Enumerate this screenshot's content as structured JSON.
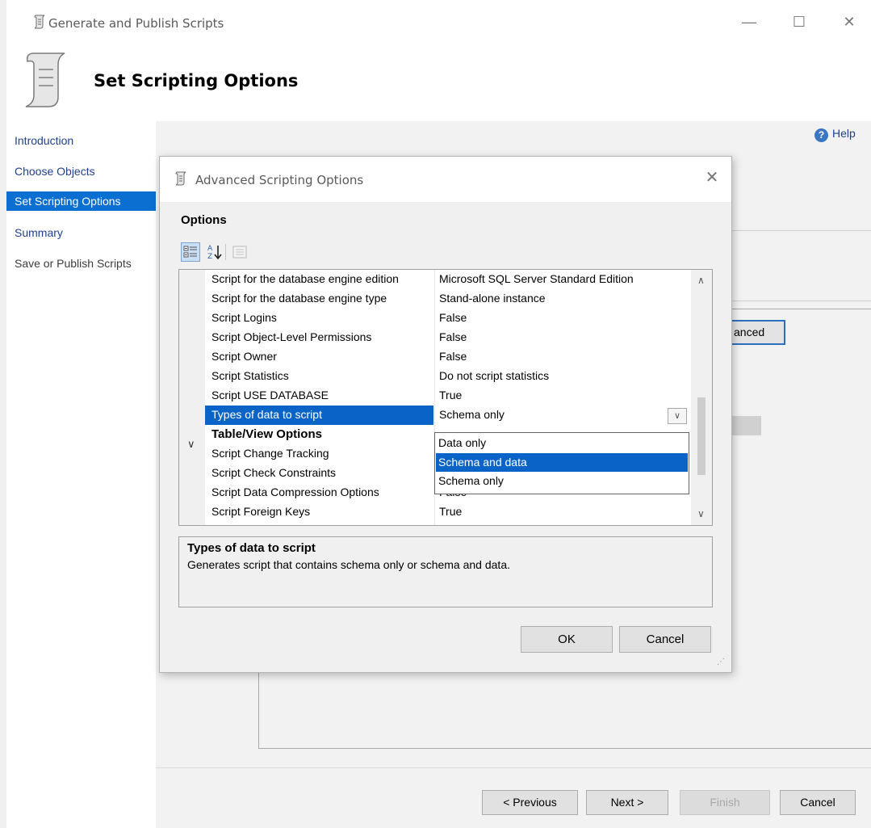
{
  "window": {
    "title": "Generate and Publish Scripts",
    "minimize": "—",
    "maximize": "☐",
    "close": "✕"
  },
  "header": {
    "title": "Set Scripting Options"
  },
  "help": {
    "label": "Help",
    "icon": "?"
  },
  "sidebar": {
    "items": [
      {
        "label": "Introduction"
      },
      {
        "label": "Choose Objects"
      },
      {
        "label": "Set Scripting Options"
      },
      {
        "label": "Summary"
      },
      {
        "label": "Save or Publish Scripts"
      }
    ]
  },
  "background": {
    "advanced_button_label": "anced"
  },
  "footer": {
    "previous": "< Previous",
    "next": "Next >",
    "finish": "Finish",
    "cancel": "Cancel"
  },
  "dialog": {
    "title": "Advanced Scripting Options",
    "close": "✕",
    "options_label": "Options",
    "grid": {
      "rows": [
        {
          "name": "Script for the database engine edition",
          "value": "Microsoft SQL Server Standard Edition"
        },
        {
          "name": "Script for the database engine type",
          "value": "Stand-alone instance"
        },
        {
          "name": "Script Logins",
          "value": "False"
        },
        {
          "name": "Script Object-Level Permissions",
          "value": "False"
        },
        {
          "name": "Script Owner",
          "value": "False"
        },
        {
          "name": "Script Statistics",
          "value": "Do not script statistics"
        },
        {
          "name": "Script USE DATABASE",
          "value": "True"
        },
        {
          "name": "Types of data to script",
          "value": "Schema only"
        },
        {
          "name": "Table/View Options",
          "value": ""
        },
        {
          "name": "Script Change Tracking",
          "value": ""
        },
        {
          "name": "Script Check Constraints",
          "value": ""
        },
        {
          "name": "Script Data Compression Options",
          "value": "False"
        },
        {
          "name": "Script Foreign Keys",
          "value": "True"
        }
      ]
    },
    "dropdown": {
      "options": [
        "Data only",
        "Schema and data",
        "Schema only"
      ],
      "highlighted": "Schema and data"
    },
    "description": {
      "title": "Types of data to script",
      "text": "Generates script that contains schema only or schema and data."
    },
    "ok": "OK",
    "cancel": "Cancel"
  },
  "colors": {
    "accent": "#0a64c8",
    "sidebar_active": "#0b6ed1",
    "link": "#1f3f8f"
  }
}
